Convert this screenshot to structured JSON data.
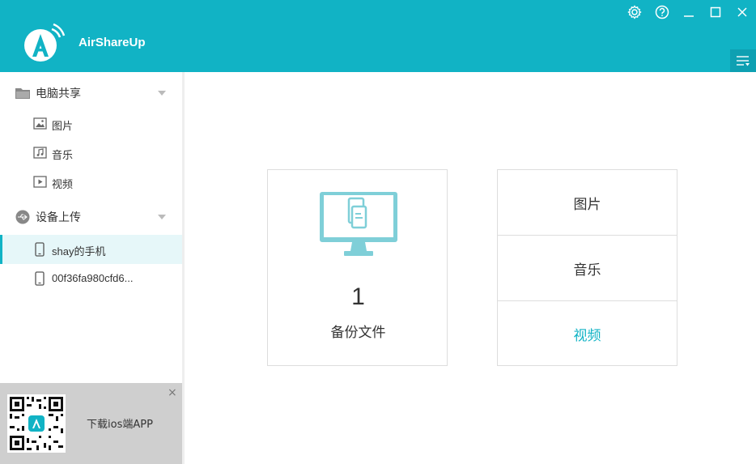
{
  "app": {
    "title": "AirShareUp"
  },
  "window_controls": [
    "gear-icon",
    "help-icon",
    "minimize-icon",
    "maximize-icon",
    "close-icon"
  ],
  "sidebar": {
    "computer_share": {
      "label": "电脑共享",
      "items": [
        {
          "label": "图片",
          "icon": "image-icon"
        },
        {
          "label": "音乐",
          "icon": "music-icon"
        },
        {
          "label": "视频",
          "icon": "video-icon"
        }
      ]
    },
    "device_upload": {
      "label": "设备上传",
      "devices": [
        {
          "label": "shay的手机",
          "active": true
        },
        {
          "label": "00f36fa980cfd6...",
          "active": false
        }
      ]
    }
  },
  "promo": {
    "text": "下载ios端APP",
    "close": "×"
  },
  "main": {
    "backup": {
      "count": "1",
      "label": "备份文件"
    },
    "categories": [
      {
        "label": "图片",
        "highlighted": false
      },
      {
        "label": "音乐",
        "highlighted": false
      },
      {
        "label": "视频",
        "highlighted": true
      }
    ]
  },
  "colors": {
    "accent": "#11b3c5",
    "accent_dark": "#0ea0b2",
    "icon_monitor": "#7fcfd8"
  }
}
